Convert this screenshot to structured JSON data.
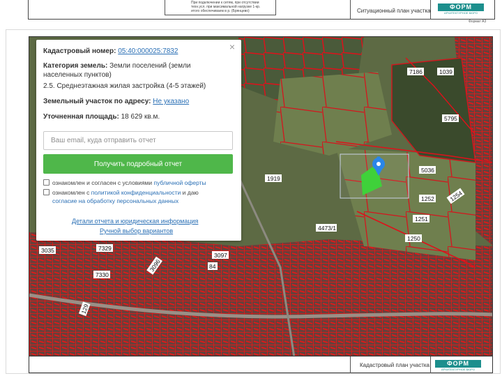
{
  "top_sheet": {
    "stamp_text_1": "При подключении к сетям, при отсутствии",
    "stamp_text_2": "техн.усл. при максимальной нагрузке 1-кр.",
    "stamp_text_3": "итого обеспечиваем в р. (Брянцево)",
    "title": "Ситуационный план участка",
    "format": "Формат А3"
  },
  "logo": {
    "name": "ФОРМ",
    "subtitle": "АРХИТЕКТУРНОЕ БЮРО"
  },
  "popup": {
    "close_glyph": "×",
    "cadastral_label": "Кадастровый номер:",
    "cadastral_value": "05:40:000025:7832",
    "category_label": "Категория земель:",
    "category_value_1": "Земли поселений (земли",
    "category_value_2": "населенных пунктов)",
    "category_value_3": "2.5. Среднеэтажная жилая застройка (4-5 этажей)",
    "address_label": "Земельный участок по адресу:",
    "address_value": "Не указано",
    "area_label": "Уточненная площадь:",
    "area_value": "18 629 кв.м.",
    "email_placeholder": "Ваш email, куда отправить отчет",
    "email_value": "",
    "button_label": "Получить подробный отчет",
    "consent1_text": "ознакомлен и согласен с условиями",
    "consent1_link": "публичной оферты",
    "consent2_text": "ознакомлен с",
    "consent2_link": "политикой конфиденциальности",
    "consent2_text2": "и даю",
    "consent2_link2": "согласие на обработку персональных данных",
    "details_link": "Детали отчета и юридическая информация",
    "manual_link": "Ручной выбор вариантов"
  },
  "map_labels": [
    "7186",
    "1039",
    "5795",
    "1919",
    "5036",
    "1254",
    "1252",
    "1251",
    "4473/1",
    "1250",
    "3035",
    "7329",
    "3097",
    "3096",
    "84",
    "7330",
    "129"
  ],
  "bottom": {
    "title": "Кадастровый план участка"
  },
  "colors": {
    "parcel_outline": "#e0101a",
    "selected_parcel": "#3fd13a",
    "marker": "#2a86e8",
    "button": "#4fb74a",
    "link": "#2a6fb5",
    "logo": "#1c8f8d"
  }
}
